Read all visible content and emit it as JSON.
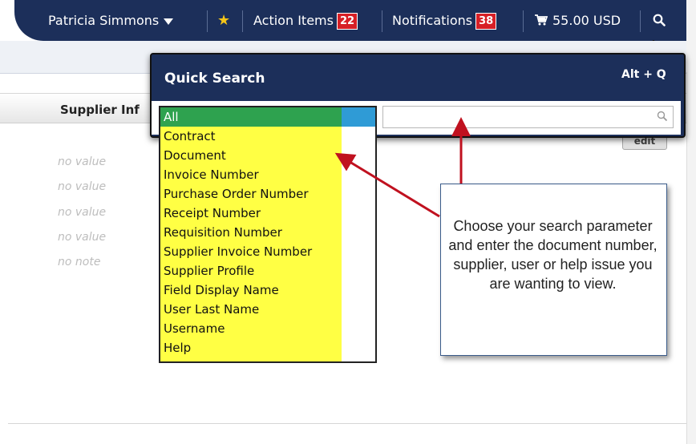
{
  "topnav": {
    "user_name": "Patricia Simmons",
    "action_items_label": "Action Items",
    "action_items_count": "22",
    "notifications_label": "Notifications",
    "notifications_count": "38",
    "cart_amount": "55.00 USD"
  },
  "section": {
    "title": "Supplier Inf",
    "edit_label": "edit",
    "values": [
      "no value",
      "no value",
      "no value",
      "no value",
      "no note"
    ]
  },
  "quick_search": {
    "title": "Quick Search",
    "shortcut": "Alt + Q",
    "search_value": "",
    "options": [
      "All",
      "Contract",
      "Document",
      "Invoice Number",
      "Purchase Order Number",
      "Receipt Number",
      "Requisition Number",
      "Supplier Invoice Number",
      "Supplier Profile",
      "Field Display Name",
      "User Last Name",
      "Username",
      "Help"
    ],
    "selected": "All"
  },
  "callout": {
    "text": "Choose your search parameter and enter the document number, supplier, user or help issue you are wanting to view."
  },
  "colors": {
    "nav_bg": "#1c2f5a",
    "badge": "#d71f26",
    "highlight": "#ffff44",
    "selected": "#2ea24f",
    "arrow": "#c0111f"
  }
}
